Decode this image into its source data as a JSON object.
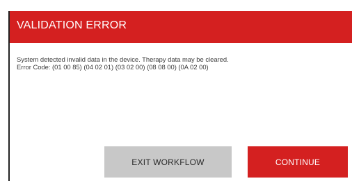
{
  "dialog": {
    "title": "VALIDATION ERROR",
    "message_line1": "System detected invalid data in the device. Therapy data may be cleared.",
    "message_line2": "Error Code: (01 00 85)  (04 02 01)  (03 02 00)  (08 08 00)  (0A 02 00)"
  },
  "buttons": {
    "exit_label": "EXIT WORKFLOW",
    "continue_label": "CONTINUE"
  },
  "colors": {
    "accent": "#d42020",
    "secondary_button": "#c8c8c8"
  }
}
